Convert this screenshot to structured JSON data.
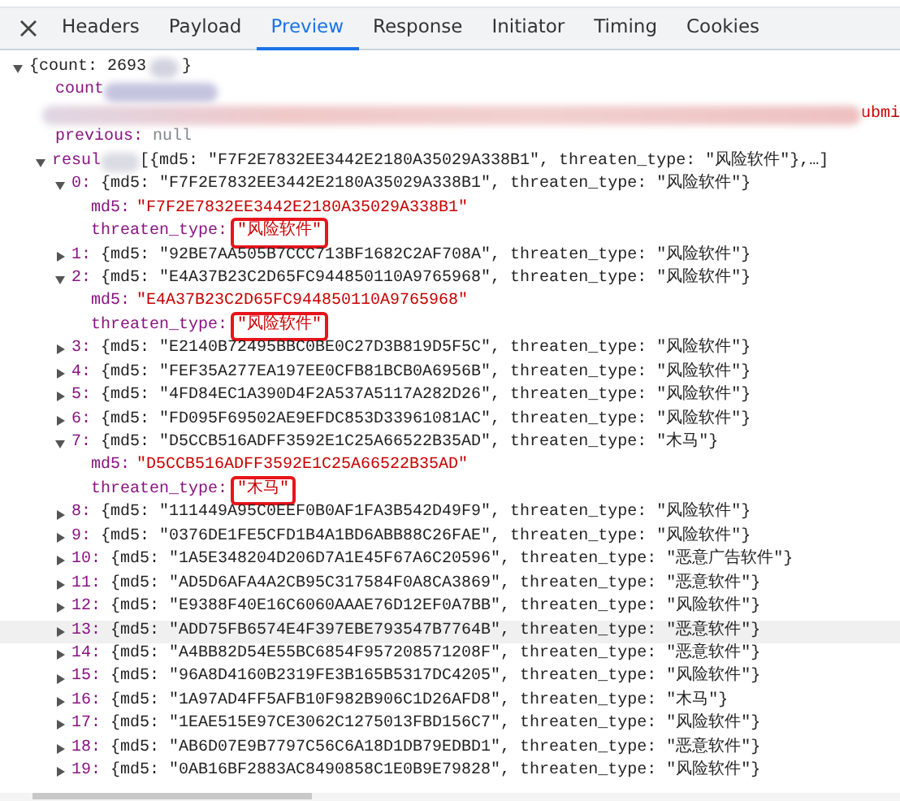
{
  "tabs": [
    {
      "label": "Headers",
      "selected": false
    },
    {
      "label": "Payload",
      "selected": false
    },
    {
      "label": "Preview",
      "selected": true
    },
    {
      "label": "Response",
      "selected": false
    },
    {
      "label": "Initiator",
      "selected": false
    },
    {
      "label": "Timing",
      "selected": false
    },
    {
      "label": "Cookies",
      "selected": false
    }
  ],
  "tree": {
    "head": "{count: 2693",
    "tail": "}",
    "expanded": true,
    "fields": [
      {
        "kind": "redacted",
        "key": "count"
      },
      {
        "kind": "redacted",
        "tail": "ubmi"
      },
      {
        "kind": "plain",
        "key": "previous:",
        "value": "null"
      }
    ],
    "results": {
      "key": "resul",
      "summary": "[{md5: \"F7F2E7832EE3442E2180A35029A338B1\", threaten_type: \"风险软件\"},…]",
      "expanded": true,
      "items": [
        {
          "index": "0:",
          "summary": "{md5: \"F7F2E7832EE3442E2180A35029A338B1\", threaten_type: \"风险软件\"}",
          "expanded": true,
          "hovered": false,
          "fields": [
            {
              "key": "md5:",
              "value": "\"F7F2E7832EE3442E2180A35029A338B1\"",
              "boxed": false
            },
            {
              "key": "threaten_type:",
              "value": "\"风险软件\"",
              "boxed": true
            }
          ]
        },
        {
          "index": "1:",
          "summary": "{md5: \"92BE7AA505B7CCC713BF1682C2AF708A\", threaten_type: \"风险软件\"}",
          "expanded": false,
          "hovered": false
        },
        {
          "index": "2:",
          "summary": "{md5: \"E4A37B23C2D65FC944850110A9765968\", threaten_type: \"风险软件\"}",
          "expanded": true,
          "hovered": false,
          "fields": [
            {
              "key": "md5:",
              "value": "\"E4A37B23C2D65FC944850110A9765968\"",
              "boxed": false
            },
            {
              "key": "threaten_type:",
              "value": "\"风险软件\"",
              "boxed": true
            }
          ]
        },
        {
          "index": "3:",
          "summary": "{md5: \"E2140B72495BBC0BE0C27D3B819D5F5C\", threaten_type: \"风险软件\"}",
          "expanded": false,
          "hovered": false
        },
        {
          "index": "4:",
          "summary": "{md5: \"FEF35A277EA197EE0CFB81BCB0A6956B\", threaten_type: \"风险软件\"}",
          "expanded": false,
          "hovered": false
        },
        {
          "index": "5:",
          "summary": "{md5: \"4FD84EC1A390D4F2A537A5117A282D26\", threaten_type: \"风险软件\"}",
          "expanded": false,
          "hovered": false
        },
        {
          "index": "6:",
          "summary": "{md5: \"FD095F69502AE9EFDC853D33961081AC\", threaten_type: \"风险软件\"}",
          "expanded": false,
          "hovered": false
        },
        {
          "index": "7:",
          "summary": "{md5: \"D5CCB516ADFF3592E1C25A66522B35AD\", threaten_type: \"木马\"}",
          "expanded": true,
          "hovered": false,
          "fields": [
            {
              "key": "md5:",
              "value": "\"D5CCB516ADFF3592E1C25A66522B35AD\"",
              "boxed": false
            },
            {
              "key": "threaten_type:",
              "value": "\"木马\"",
              "boxed": true
            }
          ]
        },
        {
          "index": "8:",
          "summary": "{md5: \"111449A95C0EEF0B0AF1FA3B542D49F9\", threaten_type: \"风险软件\"}",
          "expanded": false,
          "hovered": false
        },
        {
          "index": "9:",
          "summary": "{md5: \"0376DE1FE5CFD1B4A1BD6ABB88C26FAE\", threaten_type: \"风险软件\"}",
          "expanded": false,
          "hovered": false
        },
        {
          "index": "10:",
          "summary": "{md5: \"1A5E348204D206D7A1E45F67A6C20596\", threaten_type: \"恶意广告软件\"}",
          "expanded": false,
          "hovered": false
        },
        {
          "index": "11:",
          "summary": "{md5: \"AD5D6AFA4A2CB95C317584F0A8CA3869\", threaten_type: \"恶意软件\"}",
          "expanded": false,
          "hovered": false
        },
        {
          "index": "12:",
          "summary": "{md5: \"E9388F40E16C6060AAAE76D12EF0A7BB\", threaten_type: \"风险软件\"}",
          "expanded": false,
          "hovered": false
        },
        {
          "index": "13:",
          "summary": "{md5: \"ADD75FB6574E4F397EBE793547B7764B\", threaten_type: \"恶意软件\"}",
          "expanded": false,
          "hovered": true
        },
        {
          "index": "14:",
          "summary": "{md5: \"A4BB82D54E55BC6854F957208571208F\", threaten_type: \"恶意软件\"}",
          "expanded": false,
          "hovered": false
        },
        {
          "index": "15:",
          "summary": "{md5: \"96A8D4160B2319FE3B165B5317DC4205\", threaten_type: \"风险软件\"}",
          "expanded": false,
          "hovered": false
        },
        {
          "index": "16:",
          "summary": "{md5: \"1A97AD4FF5AFB10F982B906C1D26AFD8\", threaten_type: \"木马\"}",
          "expanded": false,
          "hovered": false
        },
        {
          "index": "17:",
          "summary": "{md5: \"1EAE515E97CE3062C1275013FBD156C7\", threaten_type: \"风险软件\"}",
          "expanded": false,
          "hovered": false
        },
        {
          "index": "18:",
          "summary": "{md5: \"AB6D07E9B7797C56C6A18D1DB79EDBD1\", threaten_type: \"恶意软件\"}",
          "expanded": false,
          "hovered": false
        },
        {
          "index": "19:",
          "summary": "{md5: \"0AB16BF2883AC8490858C1E0B9E79828\", threaten_type: \"风险软件\"}",
          "expanded": false,
          "hovered": false
        }
      ]
    }
  }
}
